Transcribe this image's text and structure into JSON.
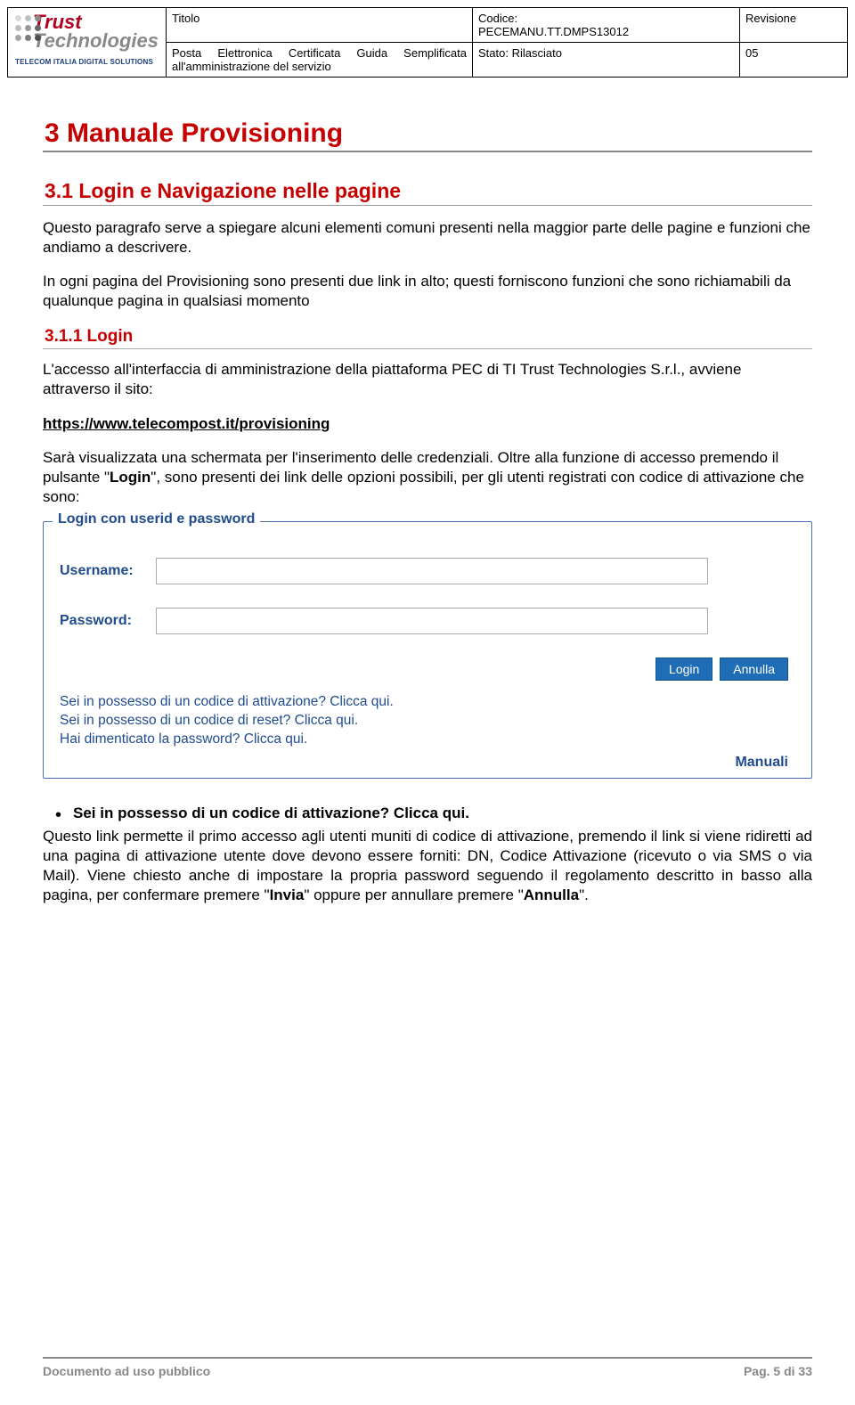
{
  "header": {
    "logo_line1": "Trust",
    "logo_line2": "Technologies",
    "logo_sub": "TELECOM ITALIA DIGITAL SOLUTIONS",
    "titolo_label": "Titolo",
    "codice_label": "Codice:",
    "codice_value": "PECEMANU.TT.DMPS13012",
    "revisione_label": "Revisione",
    "desc": "Posta Elettronica Certificata Guida Semplificata all'amministrazione del servizio",
    "stato_label": "Stato:",
    "stato_value": "Rilasciato",
    "rev_value": "05"
  },
  "sections": {
    "h1": "3   Manuale Provisioning",
    "h2": "3.1  Login e Navigazione nelle pagine",
    "p1": "Questo paragrafo serve a spiegare alcuni elementi comuni presenti nella maggior parte delle pagine e funzioni che andiamo a descrivere.",
    "p2": "In ogni pagina del Provisioning sono presenti due link in alto; questi forniscono funzioni che sono richiamabili da qualunque pagina in qualsiasi momento",
    "h3": "3.1.1  Login",
    "p3": "L'accesso all'interfaccia di amministrazione della piattaforma PEC di TI Trust Technologies S.r.l., avviene attraverso il sito:",
    "url": "https://www.telecompost.it/provisioning",
    "p4a": "Sarà visualizzata una schermata per l'inserimento delle credenziali. Oltre alla funzione di accesso premendo il pulsante \"",
    "p4b": "Login",
    "p4c": "\", sono presenti dei link delle opzioni possibili, per gli utenti registrati con codice di attivazione che sono:",
    "bullet": "Sei in possesso di un codice di attivazione? Clicca qui.",
    "p5a": "Questo link permette il primo accesso agli utenti muniti di codice di attivazione, premendo il link si viene ridiretti ad una pagina di attivazione utente dove devono essere forniti: DN, Codice Attivazione (ricevuto o via SMS o via Mail). Viene chiesto anche di impostare la propria password seguendo il regolamento descritto in basso alla pagina, per confermare premere \"",
    "p5b": "Invia",
    "p5c": "\" oppure per annullare premere \"",
    "p5d": "Annulla",
    "p5e": "\"."
  },
  "form": {
    "legend": "Login con userid e password",
    "username_label": "Username:",
    "password_label": "Password:",
    "btn_login": "Login",
    "btn_cancel": "Annulla",
    "link1": "Sei in possesso di un codice di attivazione? Clicca qui.",
    "link2": "Sei in possesso di un codice di reset? Clicca qui.",
    "link3": "Hai dimenticato la password? Clicca qui.",
    "manuali": "Manuali"
  },
  "footer": {
    "left": "Documento ad uso pubblico",
    "right": "Pag. 5 di 33"
  }
}
